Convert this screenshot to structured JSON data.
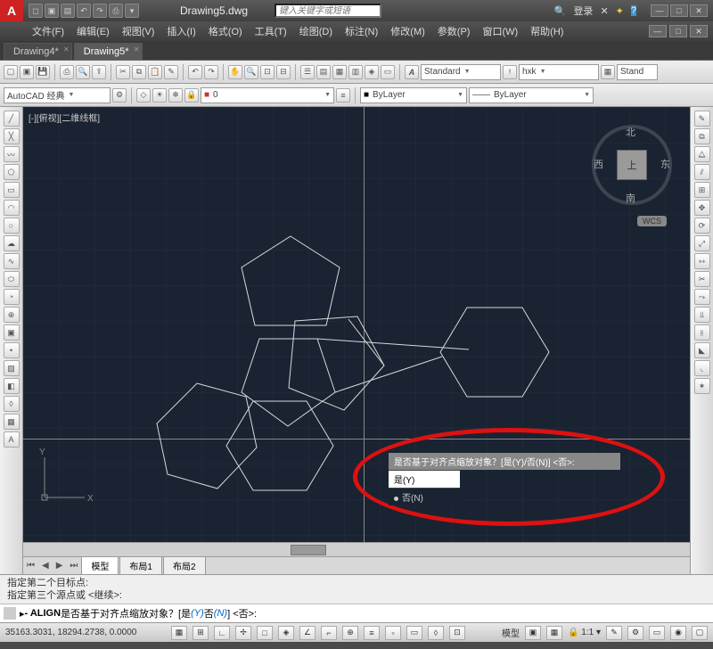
{
  "title": "Drawing5.dwg",
  "search_placeholder": "键入关键字或短语",
  "login_label": "登录",
  "menus": [
    "文件(F)",
    "编辑(E)",
    "视图(V)",
    "插入(I)",
    "格式(O)",
    "工具(T)",
    "绘图(D)",
    "标注(N)",
    "修改(M)",
    "参数(P)",
    "窗口(W)",
    "帮助(H)"
  ],
  "tabs": [
    {
      "label": "Drawing4*",
      "active": false
    },
    {
      "label": "Drawing5*",
      "active": true
    }
  ],
  "workspace_combo": "AutoCAD 经典",
  "text_style": "Standard",
  "dim_style": "hxk",
  "table_style": "Stand",
  "layer_combo": "ByLayer",
  "linetype_combo": "ByLayer",
  "viewport_label": "[-][俯视][二维线框]",
  "viewcube": {
    "top": "上",
    "n": "北",
    "s": "南",
    "e": "东",
    "w": "西",
    "wcs": "WCS"
  },
  "ucs": {
    "x": "X",
    "y": "Y"
  },
  "dyn_prompt": {
    "header": "是否基于对齐点缩放对象？[是(Y)/否(N)] <否>:",
    "opt_yes": "是(Y)",
    "opt_no": "否(N)"
  },
  "model_tabs": [
    "模型",
    "布局1",
    "布局2"
  ],
  "cmd_history": [
    "指定第二个目标点:",
    "指定第三个源点或 <继续>:"
  ],
  "cmd_prefix": "- ALIGN ",
  "cmd_text_a": "是否基于对齐点缩放对象？[是",
  "cmd_text_y": "(Y)",
  "cmd_text_b": " 否",
  "cmd_text_n": "(N)",
  "cmd_text_c": "] <否>:",
  "status": {
    "coords": "35163.3031, 18294.2738, 0.0000",
    "space": "模型",
    "scale": "1:1"
  }
}
